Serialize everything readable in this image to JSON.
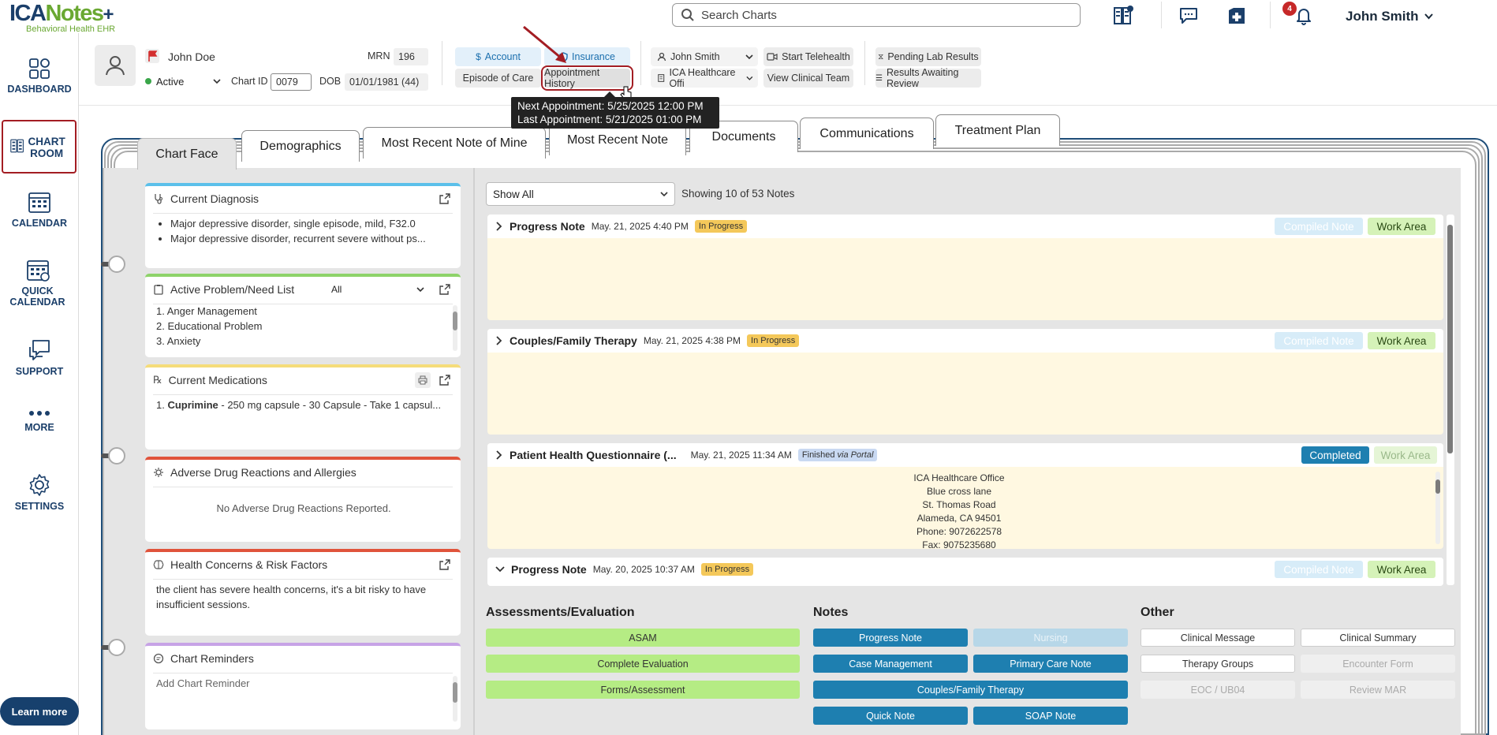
{
  "app": {
    "logo_main": "ICA",
    "logo_notes": "Notes",
    "logo_plus": "+",
    "logo_sub": "Behavioral Health EHR"
  },
  "topbar": {
    "search_placeholder": "Search Charts",
    "notification_count": "4",
    "user_name": "John Smith"
  },
  "sidebar": {
    "items": [
      {
        "label": "DASHBOARD",
        "icon": "dashboard-icon"
      },
      {
        "label": "CHART ROOM",
        "icon": "chart-room-icon",
        "selected": true
      },
      {
        "label": "CALENDAR",
        "icon": "calendar-icon"
      },
      {
        "label": "QUICK CALENDAR",
        "icon": "quick-calendar-icon"
      },
      {
        "label": "SUPPORT",
        "icon": "support-icon"
      },
      {
        "label": "MORE",
        "icon": "more-icon"
      },
      {
        "label": "SETTINGS",
        "icon": "settings-icon"
      }
    ],
    "learn_more": "Learn more"
  },
  "patient": {
    "name": "John Doe",
    "status": "Active",
    "mrn_label": "MRN",
    "mrn": "196",
    "chart_id_label": "Chart ID",
    "chart_id": "0079",
    "dob_label": "DOB",
    "dob": "01/01/1981 (44)",
    "flag_color": "#d32f2f"
  },
  "header_buttons": {
    "account": "Account",
    "insurance": "Insurance",
    "episode": "Episode of Care",
    "appointment_history": "Appointment History",
    "provider": "John Smith",
    "office": "ICA Healthcare Offi",
    "telehealth": "Start Telehealth",
    "clinical_team": "View Clinical Team",
    "pending_lab": "Pending Lab Results",
    "results_review": "Results Awaiting Review"
  },
  "tooltip": {
    "next": "Next Appointment: 5/25/2025 12:00 PM",
    "last": "Last Appointment: 5/21/2025 01:00 PM"
  },
  "tabs": [
    "Chart Face",
    "Demographics",
    "Most Recent Note of Mine",
    "Most Recent Note",
    "Documents",
    "Communications",
    "Treatment Plan"
  ],
  "cards": {
    "diagnosis": {
      "title": "Current Diagnosis",
      "items": [
        "Major depressive disorder, single episode, mild, F32.0",
        "Major depressive disorder, recurrent severe without ps..."
      ]
    },
    "problems": {
      "title": "Active Problem/Need List",
      "filter": "All",
      "items": [
        "1. Anger Management",
        "2. Educational Problem",
        "3. Anxiety"
      ]
    },
    "medications": {
      "title": "Current Medications",
      "drug": "Cuprimine",
      "line_prefix": "1.",
      "line_rest": " - 250 mg capsule - 30 Capsule - Take 1 capsul..."
    },
    "adverse": {
      "title": "Adverse Drug Reactions and Allergies",
      "empty": "No Adverse Drug Reactions Reported."
    },
    "health": {
      "title": "Health Concerns & Risk Factors",
      "text": "the client has severe health concerns, it's a bit risky to have insufficient sessions."
    },
    "reminders": {
      "title": "Chart Reminders",
      "placeholder": "Add Chart Reminder"
    }
  },
  "notes_filter": {
    "value": "Show All",
    "count_text": "Showing 10 of 53 Notes"
  },
  "notes": [
    {
      "title": "Progress Note",
      "date": "May. 21, 2025 4:40 PM",
      "status": "In Progress",
      "compiled": "Compiled Note",
      "work": "Work Area"
    },
    {
      "title": "Couples/Family Therapy",
      "date": "May. 21, 2025 4:38 PM",
      "status": "In Progress",
      "compiled": "Compiled Note",
      "work": "Work Area"
    },
    {
      "title": "Patient Health Questionnaire (...",
      "date": "May. 21, 2025 11:34 AM",
      "status": "Finished",
      "status_via": "via Portal",
      "compiled": "Completed",
      "work": "Work Area",
      "address": [
        "ICA Healthcare Office",
        "Blue cross lane",
        "St. Thomas Road",
        "Alameda, CA 94501",
        "Phone: 9072622578",
        "Fax: 9075235680"
      ]
    },
    {
      "title": "Progress Note",
      "date": "May. 20, 2025 10:37 AM",
      "status": "In Progress",
      "compiled": "Compiled Note",
      "work": "Work Area"
    }
  ],
  "sections": {
    "assessments": {
      "title": "Assessments/Evaluation",
      "buttons": [
        "ASAM",
        "Complete Evaluation",
        "Forms/Assessment"
      ]
    },
    "notes": {
      "title": "Notes",
      "buttons": [
        "Progress Note",
        "Nursing",
        "Case Management",
        "Primary Care Note",
        "Couples/Family Therapy",
        "Quick Note",
        "SOAP Note"
      ]
    },
    "other": {
      "title": "Other",
      "buttons": [
        "Clinical Message",
        "Clinical Summary",
        "Therapy Groups",
        "Encounter Form",
        "EOC / UB04",
        "Review MAR"
      ]
    }
  },
  "colors": {
    "brand_navy": "#1b3f6a",
    "brand_green": "#6aa832",
    "highlight_red": "#a31d23",
    "note_blue": "#1e7fb0",
    "assess_green": "#b5ec84"
  }
}
